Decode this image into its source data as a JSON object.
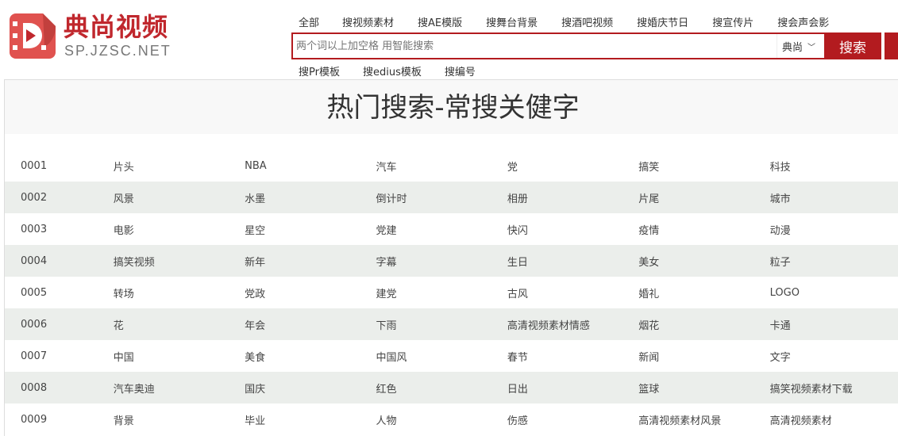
{
  "brand": {
    "name": "典尚视频",
    "domain": "SP.JZSC.NET"
  },
  "top_nav": [
    "全部",
    "搜视频素材",
    "搜AE模版",
    "搜舞台背景",
    "搜酒吧视频",
    "搜婚庆节日",
    "搜宣传片",
    "搜会声会影"
  ],
  "sub_nav": [
    "搜Pr模板",
    "搜edius模板",
    "搜编号"
  ],
  "search": {
    "placeholder": "两个词以上加空格 用智能搜索",
    "scope": "典尚",
    "button": "搜索"
  },
  "page_title": "热门搜索-常搜关健字",
  "rows": [
    [
      "0001",
      "片头",
      "NBA",
      "汽车",
      "党",
      "搞笑",
      "科技"
    ],
    [
      "0002",
      "风景",
      "水墨",
      "倒计时",
      "相册",
      "片尾",
      "城市"
    ],
    [
      "0003",
      "电影",
      "星空",
      "党建",
      "快闪",
      "疫情",
      "动漫"
    ],
    [
      "0004",
      "搞笑视频",
      "新年",
      "字幕",
      "生日",
      "美女",
      "粒子"
    ],
    [
      "0005",
      "转场",
      "党政",
      "建党",
      "古风",
      "婚礼",
      "LOGO"
    ],
    [
      "0006",
      "花",
      "年会",
      "下雨",
      "高清视频素材情感",
      "烟花",
      "卡通"
    ],
    [
      "0007",
      "中国",
      "美食",
      "中国风",
      "春节",
      "新闻",
      "文字"
    ],
    [
      "0008",
      "汽车奥迪",
      "国庆",
      "红色",
      "日出",
      "篮球",
      "搞笑视频素材下载"
    ],
    [
      "0009",
      "背景",
      "毕业",
      "人物",
      "伤感",
      "高清视频素材风景",
      "高清视频素材"
    ]
  ]
}
